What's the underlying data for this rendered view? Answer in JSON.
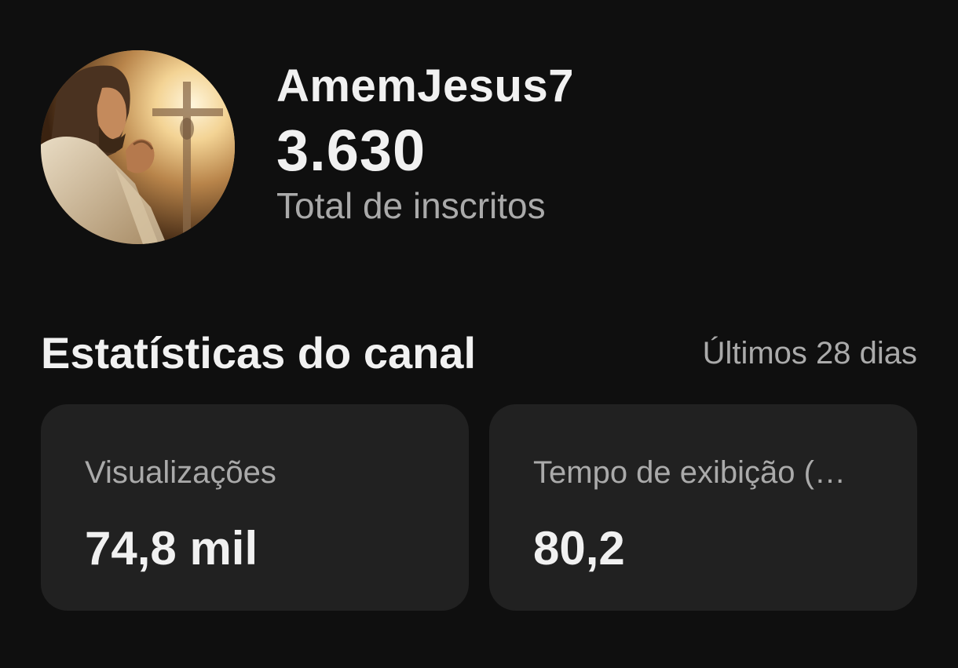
{
  "channel": {
    "name": "AmemJesus7",
    "subscriber_count": "3.630",
    "subscriber_label": "Total de inscritos",
    "avatar_icon": "channel-avatar-praying-figure-cross"
  },
  "stats": {
    "title": "Estatísticas do canal",
    "period": "Últimos 28 dias",
    "cards": [
      {
        "label": "Visualizações",
        "value": "74,8 mil"
      },
      {
        "label": "Tempo de exibição (…",
        "value": "80,2"
      }
    ]
  }
}
